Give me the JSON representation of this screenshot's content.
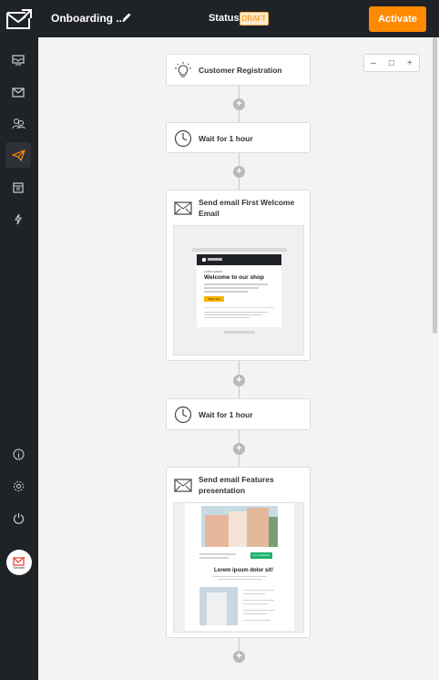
{
  "app": {
    "campaign_title": "Onboarding ...",
    "status_label": "Status:",
    "status_value": "DRAFT",
    "activate_label": "Activate"
  },
  "sidebar": {
    "items": [
      {
        "name": "dashboard",
        "icon": "monitor-icon"
      },
      {
        "name": "campaigns",
        "icon": "envelope-icon"
      },
      {
        "name": "subscribers",
        "icon": "users-icon"
      },
      {
        "name": "automation",
        "icon": "paper-plane-icon",
        "active": true
      },
      {
        "name": "forms",
        "icon": "calendar-icon"
      },
      {
        "name": "integrations",
        "icon": "lightning-icon"
      },
      {
        "name": "info",
        "icon": "info-icon"
      },
      {
        "name": "settings",
        "icon": "gear-icon"
      },
      {
        "name": "logout",
        "icon": "power-icon"
      }
    ],
    "brand_badge_label": "Sender"
  },
  "zoom": {
    "out": "–",
    "fit": "□",
    "in": "+"
  },
  "workflow": {
    "steps": [
      {
        "type": "trigger",
        "label": "Customer Registration",
        "icon": "lightbulb-icon"
      },
      {
        "type": "wait",
        "label": "Wait for 1 hour",
        "icon": "clock-icon"
      },
      {
        "type": "email",
        "label": "Send email First Welcome Email",
        "icon": "envelope-icon"
      },
      {
        "type": "wait",
        "label": "Wait for 1 hour",
        "icon": "clock-icon"
      },
      {
        "type": "email",
        "label": "Send email Features presentation",
        "icon": "envelope-icon"
      }
    ]
  },
  "preview1": {
    "small": "Lorem ipsum",
    "headline": "Welcome to our shop",
    "button": "Start now"
  },
  "preview2": {
    "headline": "Lorem ipsum dolor sit!",
    "button": "Go to Website"
  },
  "colors": {
    "sidebar": "#1f2227",
    "accent": "#ff8a00",
    "canvas": "#f3f3f3"
  }
}
